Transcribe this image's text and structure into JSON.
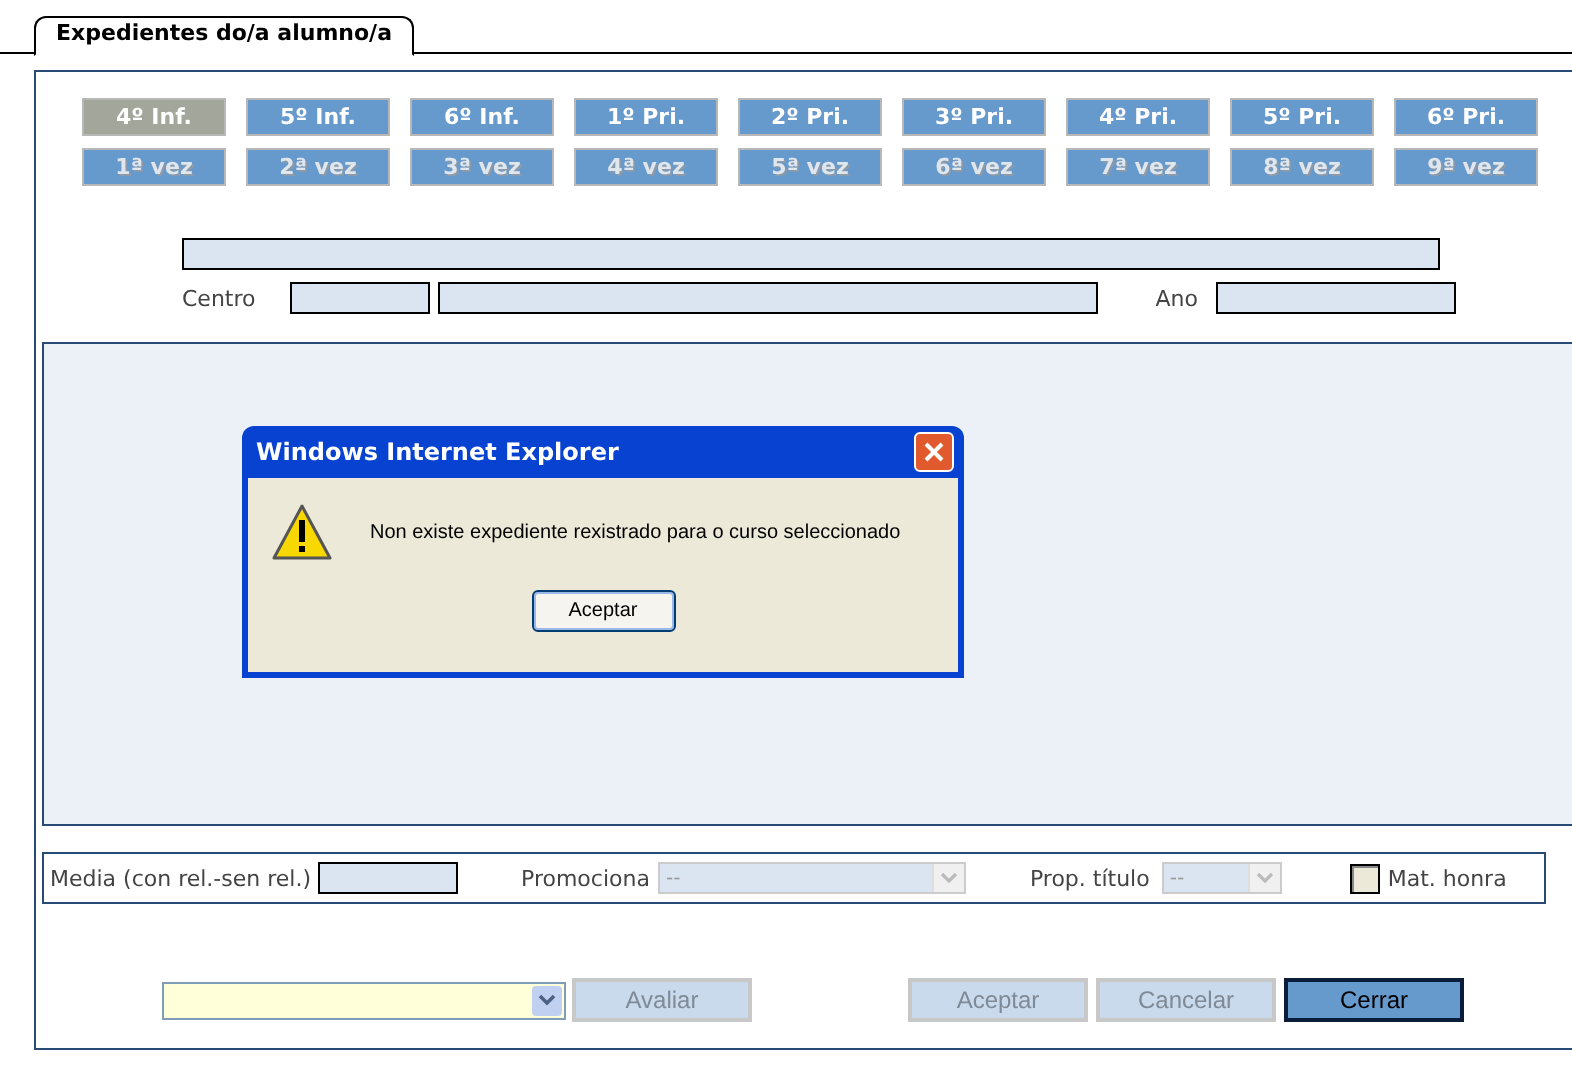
{
  "tab": {
    "label": "Expedientes do/a alumno/a",
    "selected": true
  },
  "courses": [
    {
      "label": "4º Inf.",
      "selected": true
    },
    {
      "label": "5º Inf.",
      "selected": false
    },
    {
      "label": "6º Inf.",
      "selected": false
    },
    {
      "label": "1º Pri.",
      "selected": false
    },
    {
      "label": "2º Pri.",
      "selected": false
    },
    {
      "label": "3º Pri.",
      "selected": false
    },
    {
      "label": "4º Pri.",
      "selected": false
    },
    {
      "label": "5º Pri.",
      "selected": false
    },
    {
      "label": "6º Pri.",
      "selected": false
    }
  ],
  "attempts": [
    {
      "label": "1ª vez",
      "disabled": true
    },
    {
      "label": "2ª vez",
      "disabled": true
    },
    {
      "label": "3ª vez",
      "disabled": true
    },
    {
      "label": "4ª vez",
      "disabled": true
    },
    {
      "label": "5ª vez",
      "disabled": true
    },
    {
      "label": "6ª vez",
      "disabled": true
    },
    {
      "label": "7ª vez",
      "disabled": true
    },
    {
      "label": "8ª vez",
      "disabled": true
    },
    {
      "label": "9ª vez",
      "disabled": true
    }
  ],
  "student": {
    "centro_label": "Centro",
    "ano_label": "Ano"
  },
  "dialog": {
    "title": "Windows Internet Explorer",
    "message": "Non existe expediente rexistrado para o curso seleccionado",
    "button": "Aceptar"
  },
  "grades_row": {
    "media_label": "Media (con rel.-sen rel.)",
    "promociona": {
      "label": "Promociona",
      "value": "--",
      "disabled": true
    },
    "prop_titulo": {
      "label": "Prop. título",
      "value": "--",
      "disabled": true
    },
    "honour": {
      "label": "Mat. honra",
      "checked": false,
      "disabled": true
    }
  },
  "actions": [
    {
      "label": "Avaliar",
      "disabled": true
    },
    {
      "label": "Aceptar",
      "disabled": true
    },
    {
      "label": "Cancelar",
      "disabled": true
    },
    {
      "label": "Cerrar",
      "disabled": false
    }
  ]
}
